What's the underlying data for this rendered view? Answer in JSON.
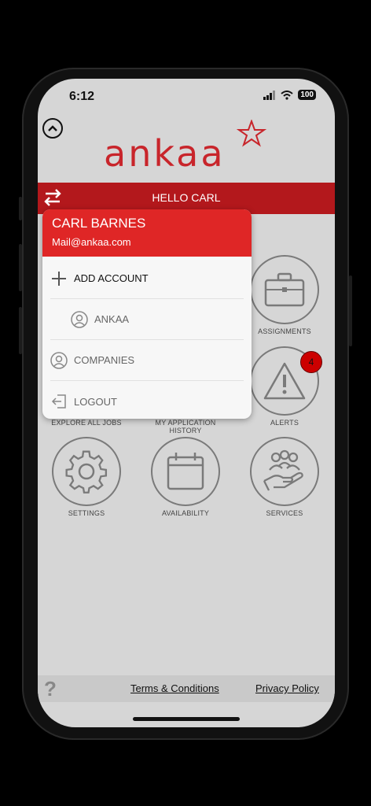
{
  "status": {
    "time": "6:12",
    "battery": "100"
  },
  "logo": {
    "text": "ankaa"
  },
  "topbar": {
    "title": "HELLO CARL"
  },
  "menu": {
    "name": "CARL BARNES",
    "email": "Mail@ankaa.com",
    "items": [
      {
        "label": "ADD ACCOUNT",
        "icon": "plus-icon"
      },
      {
        "label": "ANKAA",
        "icon": "user-circle-icon"
      },
      {
        "label": "COMPANIES",
        "icon": "user-circle-icon"
      },
      {
        "label": "LOGOUT",
        "icon": "logout-icon"
      }
    ]
  },
  "tiles": {
    "assignments": "ASSIGNMENTS",
    "explore_all_jobs": "EXPLORE ALL JOBS",
    "my_application_history": "MY APPLICATION HISTORY",
    "alerts": "ALERTS",
    "alerts_badge": "4",
    "settings": "SETTINGS",
    "availability": "AVAILABILITY",
    "services": "SERVICES"
  },
  "footer": {
    "help": "?",
    "terms": "Terms & Conditions",
    "privacy": "Privacy Policy"
  },
  "colors": {
    "brand_red": "#b3181c",
    "menu_header": "#df2626",
    "badge": "#cc0000"
  }
}
